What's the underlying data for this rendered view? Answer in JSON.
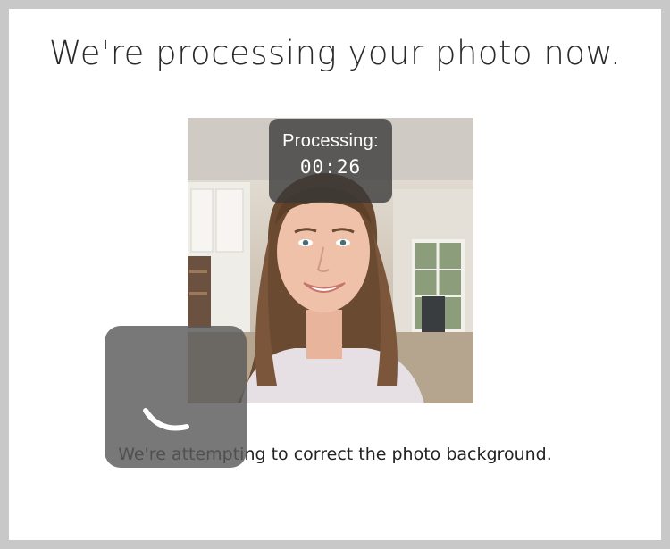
{
  "heading": "We're processing your photo now.",
  "processing": {
    "label": "Processing:",
    "timer": "00:26"
  },
  "photo": {
    "alt": "Selfie photo of a smiling woman with long wavy brown hair in a bright room"
  },
  "spinner": {
    "icon": "loading-spinner-icon"
  },
  "status_message": "We're attempting to correct the photo background."
}
